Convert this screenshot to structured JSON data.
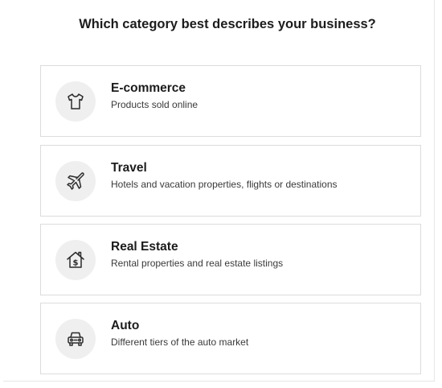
{
  "question": "Which category best describes your business?",
  "options": [
    {
      "title": "E-commerce",
      "description": "Products sold online",
      "icon": "tshirt-icon"
    },
    {
      "title": "Travel",
      "description": "Hotels and vacation properties, flights or destinations",
      "icon": "airplane-icon"
    },
    {
      "title": "Real Estate",
      "description": "Rental properties and real estate listings",
      "icon": "house-dollar-icon"
    },
    {
      "title": "Auto",
      "description": "Different tiers of the auto market",
      "icon": "car-icon"
    }
  ]
}
